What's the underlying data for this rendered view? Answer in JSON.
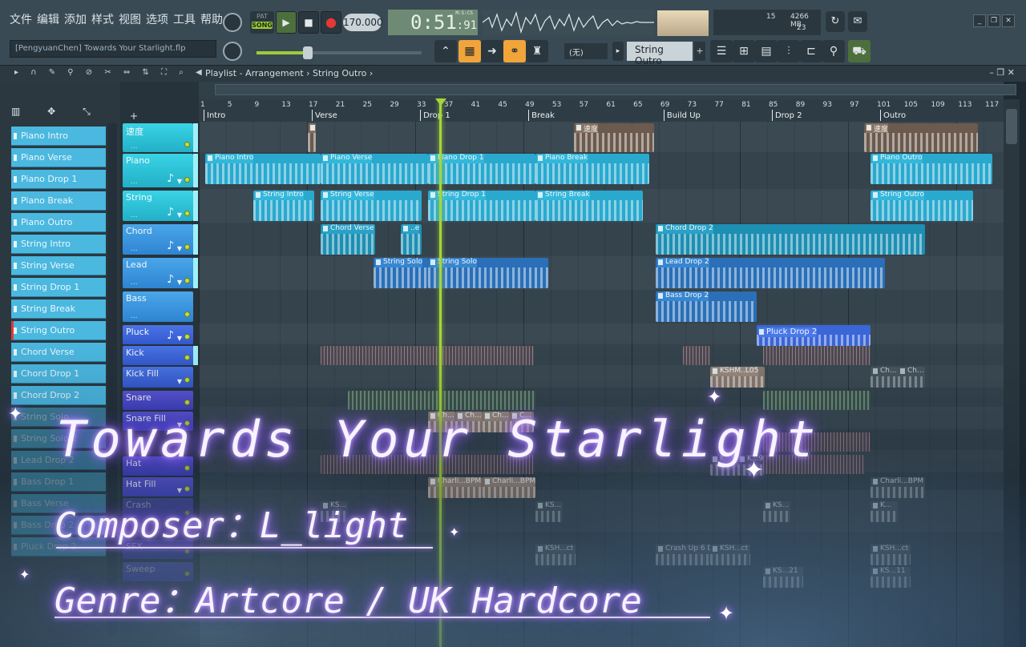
{
  "menu": [
    "文件",
    "编辑",
    "添加",
    "样式",
    "视图",
    "选项",
    "工具",
    "帮助"
  ],
  "project_title": "[PengyuanChen] Towards Your Starlight.flp",
  "transport": {
    "pat_label": "PAT",
    "song_label": "SONG",
    "tempo": "170.000",
    "time_main": "0:51",
    "time_sub": ":91",
    "time_unit": "M:S:CS"
  },
  "cpu": {
    "voices": "15",
    "memory": "4266 MB",
    "cpu_count": "23"
  },
  "snap": "(无)",
  "pattern_selector": "String Outro",
  "playlist_breadcrumb": "Playlist - Arrangement › String Outro ›",
  "patterns": [
    "Piano Intro",
    "Piano Verse",
    "Piano Drop 1",
    "Piano Break",
    "Piano Outro",
    "String Intro",
    "String Verse",
    "String Drop 1",
    "String Break",
    "String Outro",
    "Chord Verse",
    "Chord Drop 1",
    "Chord Drop 2",
    "String Solo",
    "String Solo 2",
    "Lead Drop 2",
    "Bass Drop 1",
    "Bass Verse",
    "Bass Drop 2",
    "Pluck Drop 2"
  ],
  "tracks": [
    {
      "name": "速度"
    },
    {
      "name": "Piano"
    },
    {
      "name": "String"
    },
    {
      "name": "Chord"
    },
    {
      "name": "Lead"
    },
    {
      "name": "Bass"
    },
    {
      "name": "Pluck"
    },
    {
      "name": "Kick"
    },
    {
      "name": "Kick Fill"
    },
    {
      "name": "Snare"
    },
    {
      "name": "Snare Fill"
    },
    {
      "name": "Hat"
    },
    {
      "name": "Hat Fill"
    },
    {
      "name": "Crash"
    },
    {
      "name": "SFX"
    },
    {
      "name": "Sweep"
    }
  ],
  "bar_numbers": [
    "1",
    "5",
    "9",
    "13",
    "17",
    "21",
    "25",
    "29",
    "33",
    "37",
    "41",
    "45",
    "49",
    "53",
    "57",
    "61",
    "65",
    "69",
    "73",
    "77",
    "81",
    "85",
    "89",
    "93",
    "97",
    "101",
    "105",
    "109",
    "113",
    "117"
  ],
  "markers": [
    {
      "label": "Intro",
      "bar": 1
    },
    {
      "label": "Verse",
      "bar": 17
    },
    {
      "label": "Drop 1",
      "bar": 33
    },
    {
      "label": "Break",
      "bar": 49
    },
    {
      "label": "Build Up",
      "bar": 69
    },
    {
      "label": "Drop 2",
      "bar": 85
    },
    {
      "label": "Outro",
      "bar": 101
    }
  ],
  "clips": {
    "tempo1": "速度",
    "tempo2": "速度",
    "piano_intro": "Piano Intro",
    "piano_verse": "Piano Verse",
    "piano_drop1": "Piano Drop 1",
    "piano_break": "Piano Break",
    "piano_outro": "Piano Outro",
    "string_intro": "String Intro",
    "string_verse": "String Verse",
    "string_drop1": "String Drop 1",
    "string_break": "String Break",
    "string_outro": "String Outro",
    "chord_verse": "Chord Verse",
    "chord_small": "..e",
    "chord_drop2": "Chord Drop 2",
    "string_solo_a": "String Solo",
    "string_solo_b": "String Solo",
    "lead_drop2": "Lead Drop 2",
    "bass_drop2": "Bass Drop 2",
    "pluck_drop2": "Pluck Drop 2",
    "kick_fill_a": "KSHM..L05",
    "kick_fill_b": "Ch...",
    "kick_fill_c": "Ch...",
    "snare_fill_a": "Ch...",
    "snare_fill_b": "Ch...",
    "snare_fill_c": "Ch...",
    "snare_fill_d": "C...",
    "hat_fill_a": "Charli...BPM",
    "hat_fill_b": "Charli...BPM",
    "hat_fill_c": "Charli...BPM",
    "hat_a": "K...9",
    "hat_b": "K...9",
    "crash_a": "KS...",
    "crash_b": "KS...",
    "crash_c": "KS...",
    "crash_d": "K...",
    "sfx_a": "KSH...ct 04",
    "sfx_b": "Crash Up 6 Dos",
    "sfx_c": "KSH...ct 04",
    "sfx_d": "KSH...ct 04",
    "sweep_a": "KS...21",
    "sweep_b": "KS...11"
  },
  "overlay": {
    "title": "Towards Your Starlight",
    "composer": "Composer：L_light",
    "genre": "Genre：Artcore / UK Hardcore"
  }
}
